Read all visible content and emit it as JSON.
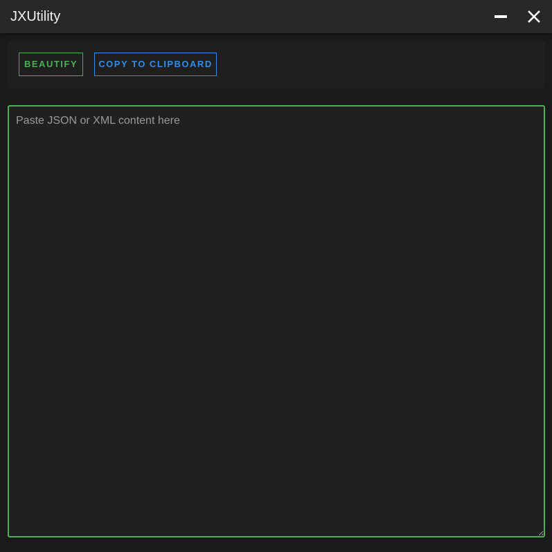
{
  "window": {
    "title": "JXUtility",
    "minimize_icon": "minimize-icon",
    "close_icon": "close-icon"
  },
  "toolbar": {
    "beautify_label": "BEAUTIFY",
    "copy_label": "COPY TO CLIPBOARD"
  },
  "editor": {
    "value": "",
    "placeholder": "Paste JSON or XML content here"
  },
  "colors": {
    "accent_green": "#4caf50",
    "accent_blue": "#2f8fe8",
    "background": "#1a1a1a",
    "titlebar": "#282828"
  }
}
